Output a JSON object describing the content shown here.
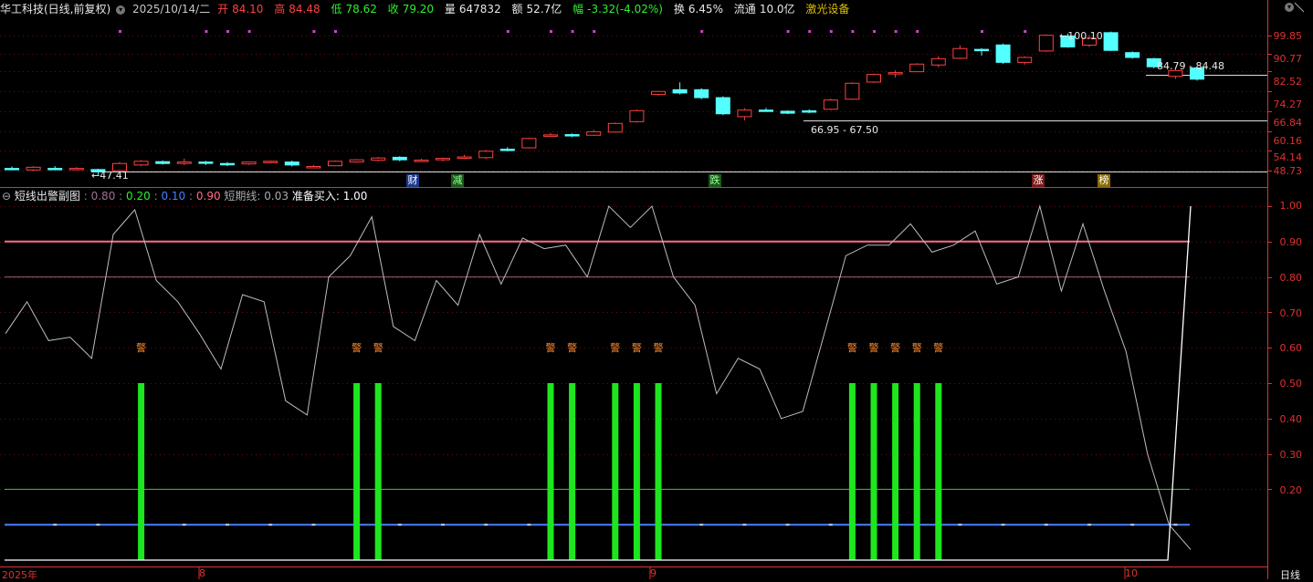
{
  "header": {
    "stock_name": "华工科技(日线,前复权)",
    "date": "2025/10/14/二",
    "open_label": "开",
    "open": "84.10",
    "high_label": "高",
    "high": "84.48",
    "low_label": "低",
    "low": "78.62",
    "close_label": "收",
    "close": "79.20",
    "volume_label": "量",
    "volume": "647832",
    "amount_label": "额",
    "amount": "52.7亿",
    "change_label": "幅",
    "change": "-3.32(-4.02%)",
    "turnover_label": "换",
    "turnover": "6.45%",
    "float_label": "流通",
    "float": "10.0亿",
    "concept": "激光设备"
  },
  "price_axis": [
    "99.85",
    "90.77",
    "82.52",
    "74.27",
    "66.84",
    "60.16",
    "54.14",
    "48.73"
  ],
  "price_annotations": {
    "high": "100.10",
    "low": "47.41",
    "range1": "84.79 - 84.48",
    "range2": "66.95 - 67.50"
  },
  "event_markers": [
    "财",
    "减",
    "跌",
    "涨",
    "榜"
  ],
  "indicator": {
    "name": "短线出警副图",
    "param1": "0.80",
    "param2": "0.20",
    "param3": "0.10",
    "param4": "0.90",
    "short_label": "短期线:",
    "short_value": "0.03",
    "ready_label": "准备买入:",
    "ready_value": "1.00",
    "alert_label": "警",
    "axis": [
      "1.00",
      "0.90",
      "0.80",
      "0.70",
      "0.60",
      "0.50",
      "0.40",
      "0.30",
      "0.20"
    ]
  },
  "x_axis": {
    "year": "2025年",
    "m8": "8",
    "m9": "9",
    "m10": "10",
    "period": "日线"
  },
  "colors": {
    "up": "#ff4040",
    "down": "#54ffff",
    "alert_bar": "#1ee61e",
    "line_090": "#ff6b8a",
    "line_080": "#a05a7a",
    "line_020": "#33cc33",
    "line_010": "#4a7fff",
    "axis": "#e03030",
    "concept": "#e0c000"
  },
  "chart_data": [
    {
      "type": "candlestick",
      "title": "华工科技(日线,前复权)",
      "y_ticks": [
        99.85,
        90.77,
        82.52,
        74.27,
        66.84,
        60.16,
        54.14,
        48.73
      ],
      "log_scale": true,
      "candles": [
        {
          "o": 49.3,
          "h": 49.8,
          "l": 48.8,
          "c": 49.0
        },
        {
          "o": 48.9,
          "h": 49.9,
          "l": 48.6,
          "c": 49.6
        },
        {
          "o": 49.3,
          "h": 49.9,
          "l": 48.9,
          "c": 49.0
        },
        {
          "o": 49.2,
          "h": 49.6,
          "l": 48.8,
          "c": 49.3
        },
        {
          "o": 49.0,
          "h": 49.2,
          "l": 47.41,
          "c": 48.5
        },
        {
          "o": 48.7,
          "h": 51.0,
          "l": 48.5,
          "c": 50.6
        },
        {
          "o": 50.2,
          "h": 51.5,
          "l": 49.9,
          "c": 51.2
        },
        {
          "o": 51.1,
          "h": 51.4,
          "l": 50.3,
          "c": 50.6
        },
        {
          "o": 50.6,
          "h": 51.9,
          "l": 50.2,
          "c": 51.0
        },
        {
          "o": 51.0,
          "h": 51.3,
          "l": 50.2,
          "c": 50.8
        },
        {
          "o": 50.6,
          "h": 51.0,
          "l": 49.9,
          "c": 50.4
        },
        {
          "o": 50.5,
          "h": 51.1,
          "l": 50.2,
          "c": 51.0
        },
        {
          "o": 51.0,
          "h": 51.4,
          "l": 50.6,
          "c": 51.2
        },
        {
          "o": 51.0,
          "h": 51.4,
          "l": 49.8,
          "c": 50.2
        },
        {
          "o": 49.8,
          "h": 50.2,
          "l": 49.5,
          "c": 49.8
        },
        {
          "o": 50.0,
          "h": 51.4,
          "l": 49.9,
          "c": 51.2
        },
        {
          "o": 51.0,
          "h": 51.8,
          "l": 50.8,
          "c": 51.6
        },
        {
          "o": 51.5,
          "h": 52.4,
          "l": 51.2,
          "c": 52.1
        },
        {
          "o": 52.3,
          "h": 52.6,
          "l": 51.2,
          "c": 51.6
        },
        {
          "o": 51.5,
          "h": 51.9,
          "l": 51.0,
          "c": 51.5
        },
        {
          "o": 51.6,
          "h": 52.2,
          "l": 51.2,
          "c": 52.0
        },
        {
          "o": 52.1,
          "h": 53.0,
          "l": 51.8,
          "c": 52.4
        },
        {
          "o": 52.2,
          "h": 54.4,
          "l": 51.8,
          "c": 54.0
        },
        {
          "o": 54.6,
          "h": 55.2,
          "l": 54.0,
          "c": 54.3
        },
        {
          "o": 55.0,
          "h": 58.0,
          "l": 54.8,
          "c": 57.8
        },
        {
          "o": 58.6,
          "h": 59.6,
          "l": 58.3,
          "c": 58.9
        },
        {
          "o": 59.0,
          "h": 59.4,
          "l": 58.2,
          "c": 58.8
        },
        {
          "o": 58.8,
          "h": 60.5,
          "l": 58.6,
          "c": 59.9
        },
        {
          "o": 59.8,
          "h": 62.9,
          "l": 59.6,
          "c": 62.6
        },
        {
          "o": 63.2,
          "h": 67.4,
          "l": 62.9,
          "c": 67.0
        },
        {
          "o": 73.0,
          "h": 74.4,
          "l": 72.6,
          "c": 74.2
        },
        {
          "o": 74.9,
          "h": 77.9,
          "l": 73.0,
          "c": 73.6
        },
        {
          "o": 74.9,
          "h": 75.5,
          "l": 71.2,
          "c": 71.8
        },
        {
          "o": 71.8,
          "h": 72.3,
          "l": 65.4,
          "c": 65.9
        },
        {
          "o": 64.9,
          "h": 67.9,
          "l": 63.6,
          "c": 67.2
        },
        {
          "o": 67.2,
          "h": 68.0,
          "l": 66.6,
          "c": 67.1
        },
        {
          "o": 66.8,
          "h": 67.1,
          "l": 65.8,
          "c": 66.1
        },
        {
          "o": 66.95,
          "h": 67.5,
          "l": 66.1,
          "c": 66.6
        },
        {
          "o": 67.5,
          "h": 71.4,
          "l": 67.2,
          "c": 70.9
        },
        {
          "o": 71.2,
          "h": 77.9,
          "l": 71.0,
          "c": 77.5
        },
        {
          "o": 78.0,
          "h": 81.6,
          "l": 77.6,
          "c": 81.2
        },
        {
          "o": 81.8,
          "h": 83.0,
          "l": 79.9,
          "c": 82.0
        },
        {
          "o": 82.4,
          "h": 86.2,
          "l": 82.2,
          "c": 85.8
        },
        {
          "o": 85.4,
          "h": 89.4,
          "l": 84.4,
          "c": 88.3
        },
        {
          "o": 88.5,
          "h": 94.8,
          "l": 88.1,
          "c": 93.2
        },
        {
          "o": 92.8,
          "h": 93.4,
          "l": 89.8,
          "c": 92.4
        },
        {
          "o": 95.0,
          "h": 95.7,
          "l": 85.9,
          "c": 86.6
        },
        {
          "o": 86.6,
          "h": 89.4,
          "l": 85.6,
          "c": 88.9
        },
        {
          "o": 92.0,
          "h": 100.5,
          "l": 91.6,
          "c": 100.0
        },
        {
          "o": 99.7,
          "h": 100.9,
          "l": 93.6,
          "c": 94.0
        },
        {
          "o": 94.9,
          "h": 100.1,
          "l": 94.0,
          "c": 98.5
        },
        {
          "o": 101.4,
          "h": 102.0,
          "l": 92.0,
          "c": 92.3
        },
        {
          "o": 91.2,
          "h": 91.8,
          "l": 88.3,
          "c": 88.9
        },
        {
          "o": 88.3,
          "h": 88.7,
          "l": 83.9,
          "c": 84.6
        },
        {
          "o": 80.4,
          "h": 83.6,
          "l": 79.3,
          "c": 82.9
        },
        {
          "o": 84.1,
          "h": 84.48,
          "l": 78.62,
          "c": 79.2
        }
      ]
    },
    {
      "type": "line",
      "title": "短线出警副图",
      "y_ticks": [
        1.0,
        0.9,
        0.8,
        0.7,
        0.6,
        0.5,
        0.4,
        0.3,
        0.2
      ],
      "reference_lines": [
        0.9,
        0.8,
        0.2,
        0.1
      ],
      "series": [
        {
          "name": "短期线",
          "values": [
            0.64,
            0.73,
            0.62,
            0.63,
            0.57,
            0.92,
            0.99,
            0.79,
            0.73,
            0.64,
            0.54,
            0.75,
            0.73,
            0.45,
            0.41,
            0.8,
            0.86,
            0.97,
            0.66,
            0.62,
            0.79,
            0.72,
            0.92,
            0.78,
            0.91,
            0.88,
            0.89,
            0.8,
            1.0,
            0.94,
            1.0,
            0.8,
            0.72,
            0.47,
            0.57,
            0.54,
            0.4,
            0.42,
            0.64,
            0.86,
            0.89,
            0.89,
            0.95,
            0.87,
            0.89,
            0.93,
            0.78,
            0.8,
            1.0,
            0.76,
            0.95,
            0.76,
            0.59,
            0.3,
            0.1,
            0.03
          ]
        },
        {
          "name": "准备买入",
          "values_note_last": 1.0
        }
      ],
      "alert_bars_index": [
        6,
        16,
        17,
        25,
        26,
        28,
        29,
        30,
        39,
        40,
        41,
        42,
        43
      ]
    }
  ]
}
